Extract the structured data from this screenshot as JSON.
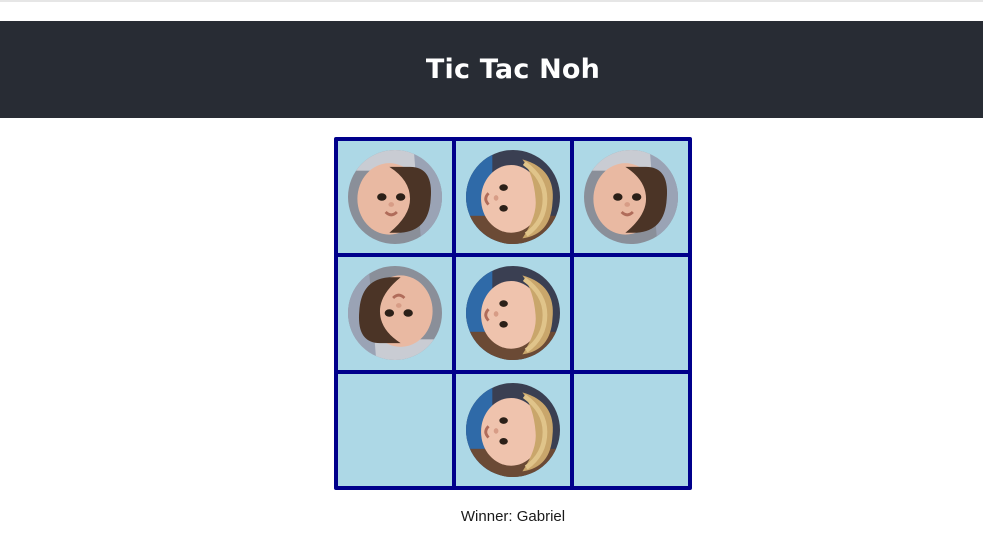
{
  "header": {
    "title": "Tic Tac Noh"
  },
  "board": {
    "cells": [
      {
        "player": "player-a",
        "orientation": "rotated-left"
      },
      {
        "player": "player-b",
        "orientation": "rotated-left"
      },
      {
        "player": "player-a",
        "orientation": "rotated-left"
      },
      {
        "player": "player-a",
        "orientation": "rotated-right"
      },
      {
        "player": "player-b",
        "orientation": "rotated-left"
      },
      {
        "player": null,
        "orientation": null
      },
      {
        "player": null,
        "orientation": null
      },
      {
        "player": "player-b",
        "orientation": "rotated-left"
      },
      {
        "player": null,
        "orientation": null
      }
    ],
    "colors": {
      "grid": "#00008b",
      "cell": "#add8e6"
    }
  },
  "status": {
    "text": "Winner: Gabriel"
  },
  "colors": {
    "header_bg": "#282c34",
    "header_text": "#ffffff",
    "page_bg": "#ffffff"
  }
}
